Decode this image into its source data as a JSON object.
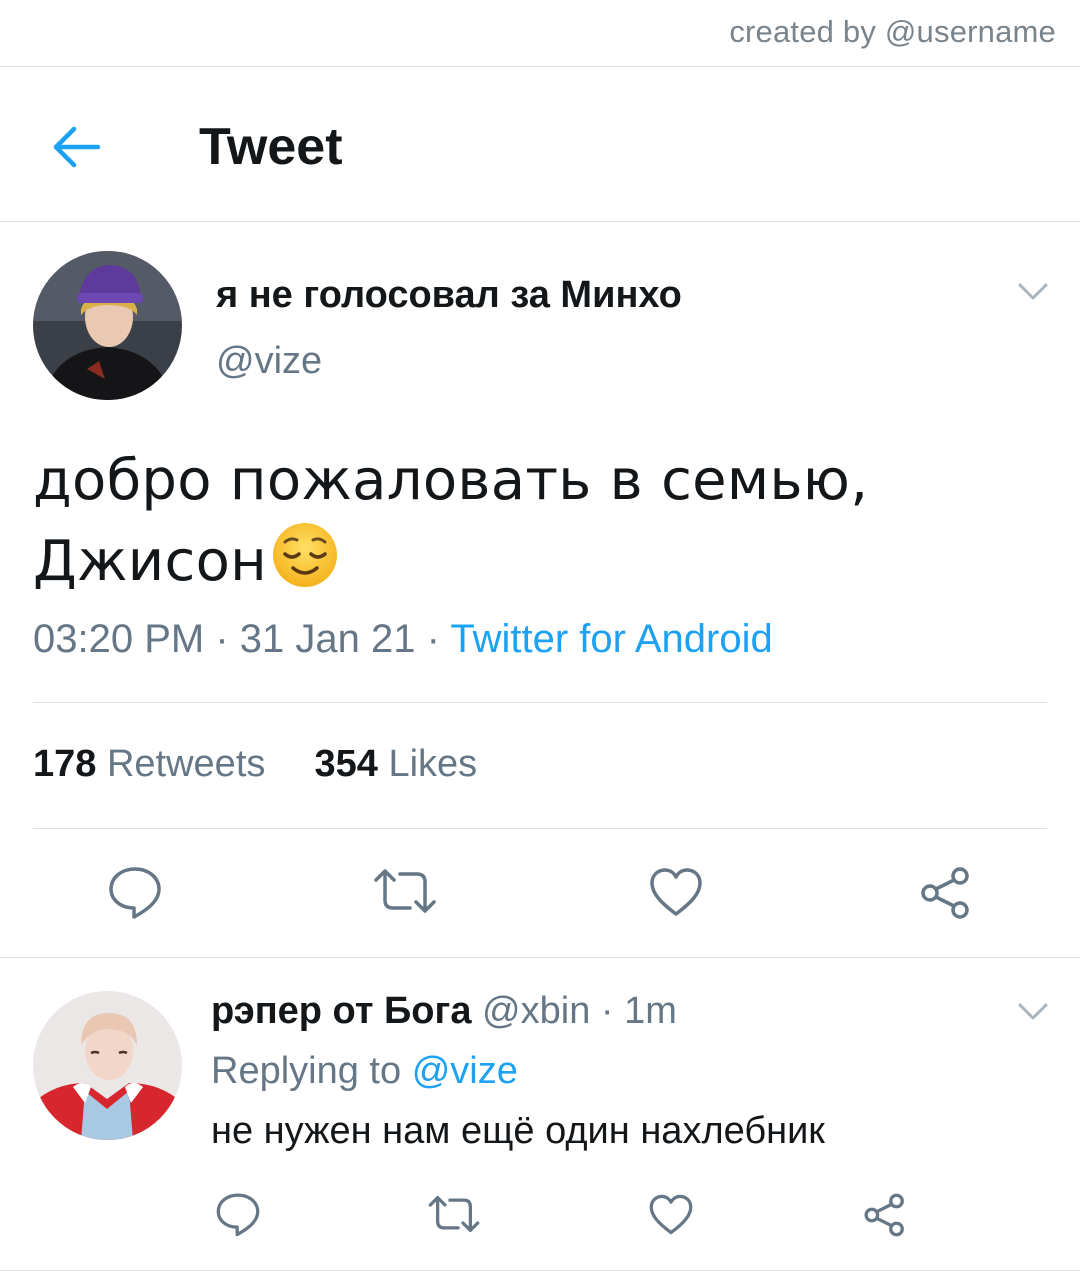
{
  "credit": "created by @username",
  "header": {
    "title": "Tweet"
  },
  "tweet": {
    "author_name": "я не голосовал за Минхо",
    "author_handle": "@vize",
    "text_line1": "добро пожаловать в семью,",
    "text_line2": "Джисон",
    "time": "03:20 PM",
    "date": "31 Jan 21",
    "separator": "·",
    "source": "Twitter for Android",
    "retweet_count": "178",
    "retweet_label": "Retweets",
    "like_count": "354",
    "like_label": "Likes"
  },
  "reply": {
    "author_name": "рэпер от Бога",
    "author_handle": "@xbin",
    "separator": "·",
    "time_ago": "1m",
    "replying_prefix": "Replying to",
    "replying_handle": "@vize",
    "text": "не нужен нам ещё один нахлебник"
  },
  "icons": {
    "back": "arrow-left-icon",
    "caret": "chevron-down-icon",
    "reply": "comment-icon",
    "retweet": "retweet-icon",
    "like": "heart-icon",
    "share": "share-icon",
    "emoji": "relieved-face-emoji"
  },
  "colors": {
    "accent": "#1da1f2",
    "text": "#14171a",
    "secondary": "#657786",
    "divider": "#dde3e8"
  }
}
